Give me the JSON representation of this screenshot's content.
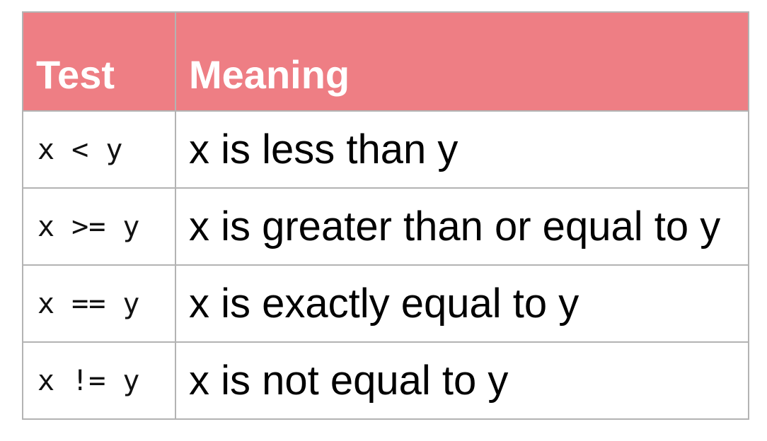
{
  "table": {
    "headers": {
      "test": "Test",
      "meaning": "Meaning"
    },
    "rows": [
      {
        "test": "x < y",
        "meaning": "x is less than y"
      },
      {
        "test": "x >= y",
        "meaning": "x is greater than or equal to y"
      },
      {
        "test": "x == y",
        "meaning": "x is exactly equal to y"
      },
      {
        "test": "x != y",
        "meaning": "x is not equal to y"
      }
    ]
  },
  "colors": {
    "header_background": "#ee7e84",
    "header_text": "#ffffff",
    "border": "#b3b3b3"
  }
}
